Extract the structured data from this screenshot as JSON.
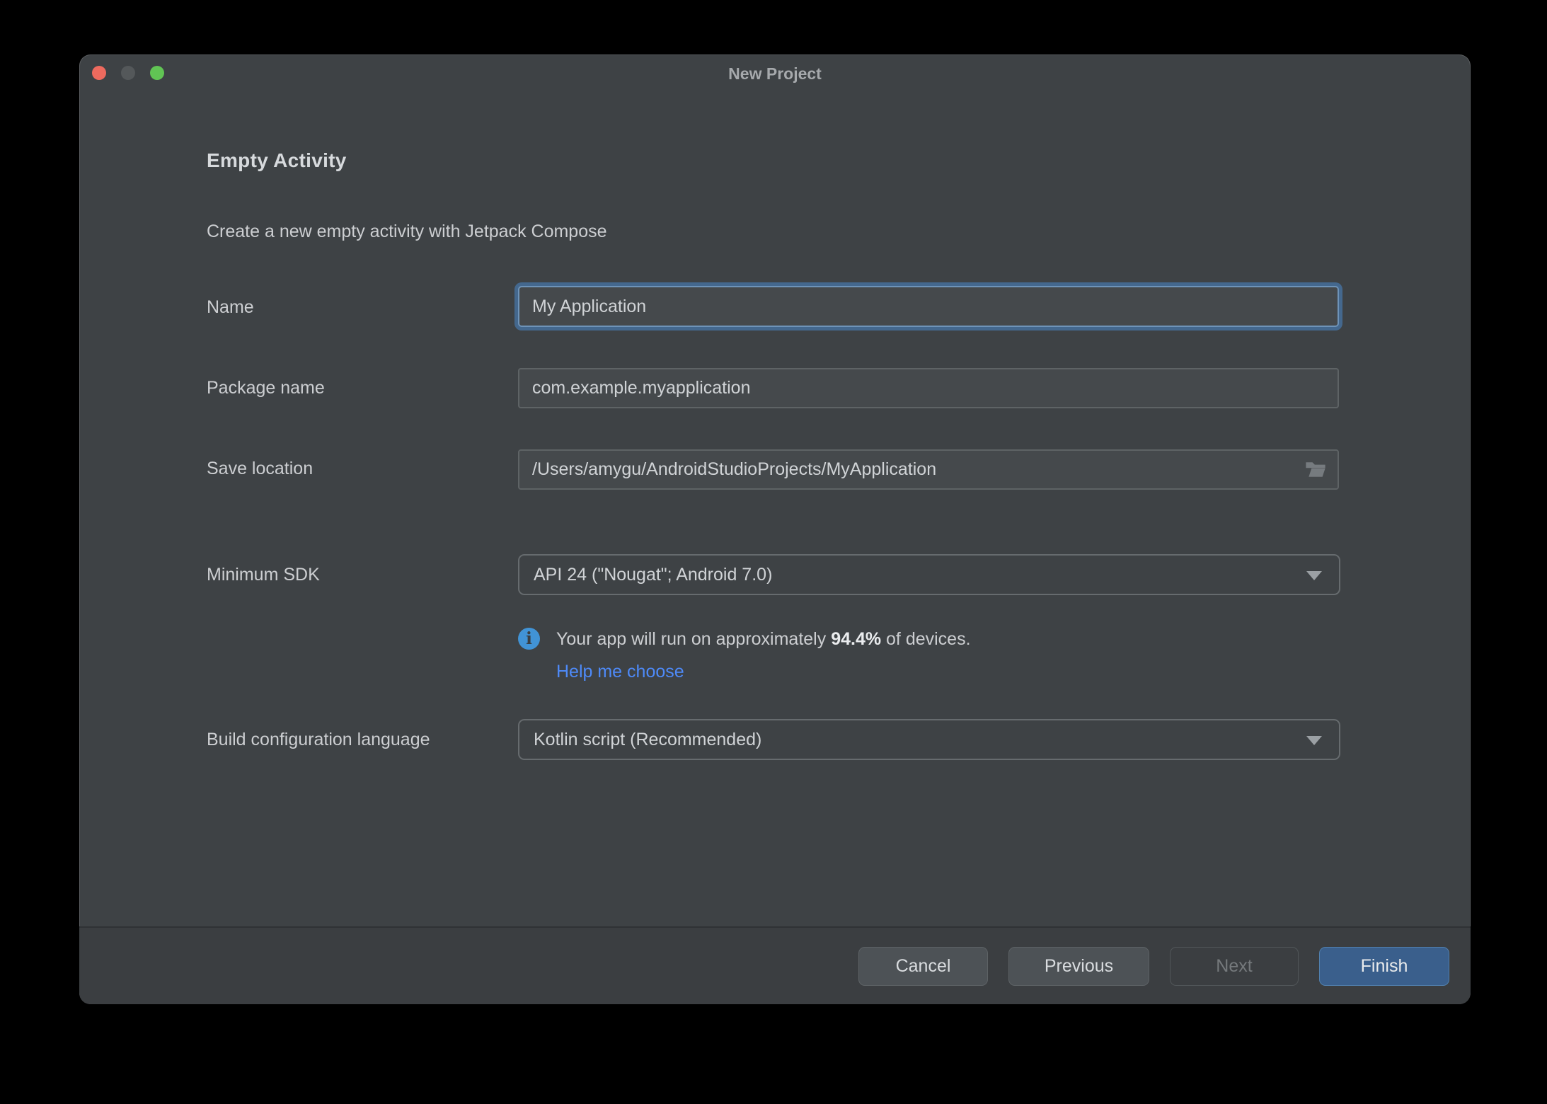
{
  "window": {
    "title": "New Project",
    "controls": {
      "close": "close-button",
      "minimize": "minimize-button",
      "zoom": "zoom-button"
    }
  },
  "header": {
    "title": "Empty Activity",
    "subtitle": "Create a new empty activity with Jetpack Compose"
  },
  "form": {
    "name": {
      "label": "Name",
      "value": "My Application",
      "focused": true
    },
    "package_name": {
      "label": "Package name",
      "value": "com.example.myapplication"
    },
    "save_location": {
      "label": "Save location",
      "value": "/Users/amygu/AndroidStudioProjects/MyApplication",
      "icon": "folder-open-icon"
    },
    "minimum_sdk": {
      "label": "Minimum SDK",
      "value": "API 24 (\"Nougat\"; Android 7.0)",
      "icon": "triangle-down-icon"
    },
    "sdk_info": {
      "icon": "info-icon",
      "text_before": "Your app will run on approximately ",
      "percent": "94.4%",
      "text_after": " of devices.",
      "link_label": "Help me choose"
    },
    "build_configuration": {
      "label": "Build configuration language",
      "value": "Kotlin script (Recommended)",
      "icon": "triangle-down-icon"
    }
  },
  "footer": {
    "buttons": [
      {
        "label": "Cancel",
        "style": "normal",
        "state": "enabled"
      },
      {
        "label": "Previous",
        "style": "normal",
        "state": "enabled"
      },
      {
        "label": "Next",
        "style": "outline",
        "state": "disabled"
      },
      {
        "label": "Finish",
        "style": "primary",
        "state": "enabled"
      }
    ]
  },
  "colors": {
    "dialog_background": "#3e4245",
    "field_background": "#45494c",
    "focus_ring": "#44688e",
    "link_blue": "#4e8af8",
    "info_icon_blue": "#4193d5",
    "finish_button_blue": "#3a5f8c",
    "traffic_red": "#ed6a5e",
    "traffic_middle_gray": "#54585a",
    "traffic_green": "#61c454"
  }
}
